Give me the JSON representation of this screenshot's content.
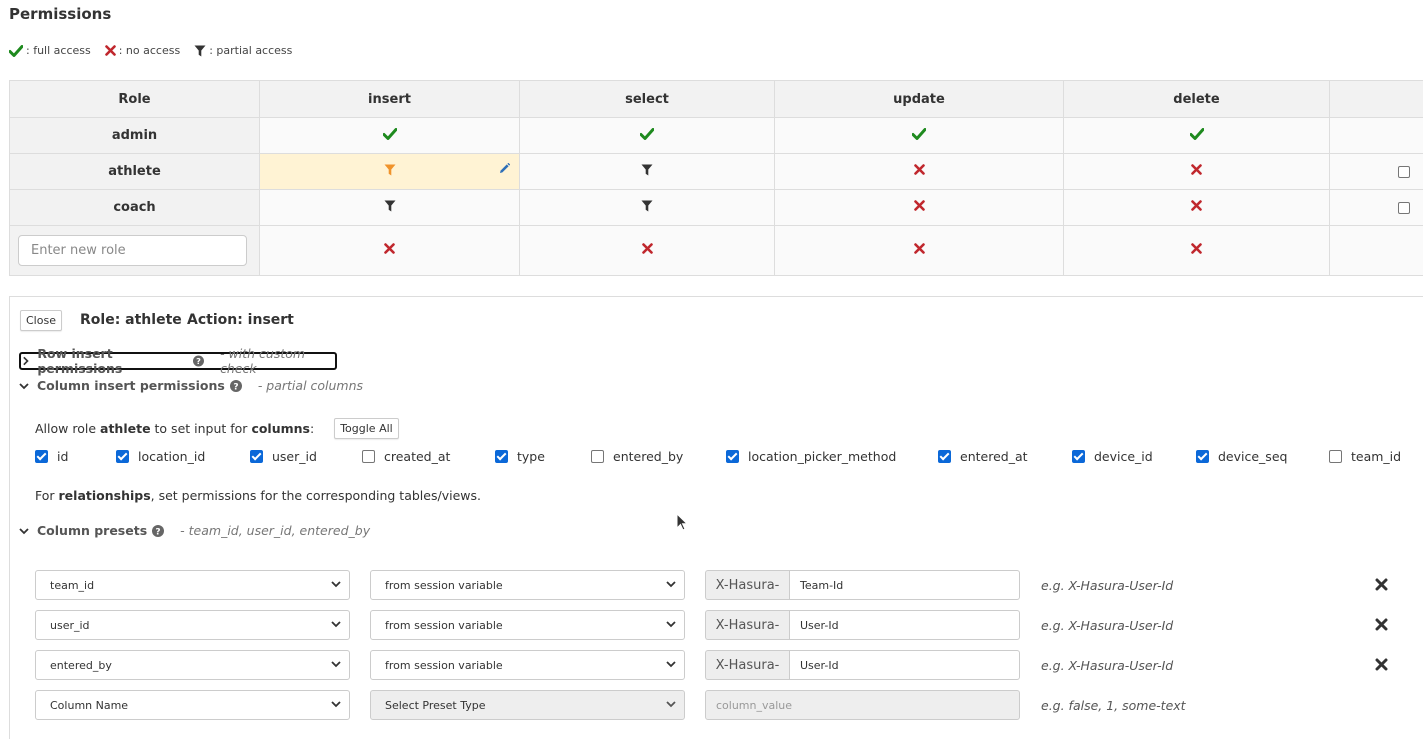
{
  "page": {
    "title": "Permissions"
  },
  "legend": {
    "full": ": full access",
    "none": ": no access",
    "partial": ": partial access"
  },
  "colors": {
    "full": "#1e8a1e",
    "none": "#c0272d",
    "partial": "#333333",
    "partial_selected": "#f0932b",
    "selected_cell": "#fff3d4",
    "pencil": "#2e6fb8"
  },
  "table": {
    "headers": {
      "role": "Role",
      "insert": "insert",
      "select": "select",
      "update": "update",
      "delete": "delete"
    },
    "rows": [
      {
        "role": "admin",
        "insert": "full",
        "select": "full",
        "update": "full",
        "delete": "full",
        "checkbox": false
      },
      {
        "role": "athlete",
        "insert": "partial",
        "select": "partial",
        "update": "none",
        "delete": "none",
        "checkbox": true
      },
      {
        "role": "coach",
        "insert": "partial",
        "select": "partial",
        "update": "none",
        "delete": "none",
        "checkbox": true
      }
    ],
    "new_role": {
      "placeholder": "Enter new role",
      "insert": "none",
      "select": "none",
      "update": "none",
      "delete": "none"
    }
  },
  "panel": {
    "close_label": "Close",
    "role_heading": "Role: athlete",
    "action_heading": "Action: insert",
    "row_section": {
      "title": "Row insert permissions",
      "subtitle": "- with custom check"
    },
    "column_section": {
      "title": "Column insert permissions",
      "subtitle": "- partial columns"
    },
    "allow": {
      "prefix": "Allow role",
      "role": "athlete",
      "middle": "to set input for",
      "columns_word": "columns",
      "suffix": ":",
      "toggle_label": "Toggle All"
    },
    "columns": [
      {
        "name": "id",
        "checked": true
      },
      {
        "name": "location_id",
        "checked": true
      },
      {
        "name": "user_id",
        "checked": true
      },
      {
        "name": "created_at",
        "checked": false
      },
      {
        "name": "type",
        "checked": true
      },
      {
        "name": "entered_by",
        "checked": false
      },
      {
        "name": "location_picker_method",
        "checked": true
      },
      {
        "name": "entered_at",
        "checked": true
      },
      {
        "name": "device_id",
        "checked": true
      },
      {
        "name": "device_seq",
        "checked": true
      },
      {
        "name": "team_id",
        "checked": false
      }
    ],
    "relationships": {
      "prefix": "For",
      "bold": "relationships",
      "suffix": ", set permissions for the corresponding tables/views."
    },
    "preset_section": {
      "title": "Column presets",
      "subtitle": "- team_id, user_id, entered_by"
    },
    "presets": [
      {
        "column": "team_id",
        "type": "from session variable",
        "prefix": "X-Hasura-",
        "value": "Team-Id",
        "example": "e.g. X-Hasura-User-Id"
      },
      {
        "column": "user_id",
        "type": "from session variable",
        "prefix": "X-Hasura-",
        "value": "User-Id",
        "example": "e.g. X-Hasura-User-Id"
      },
      {
        "column": "entered_by",
        "type": "from session variable",
        "prefix": "X-Hasura-",
        "value": "User-Id",
        "example": "e.g. X-Hasura-User-Id"
      }
    ],
    "new_preset": {
      "column": "Column Name",
      "type": "Select Preset Type",
      "value_placeholder": "column_value",
      "example": "e.g. false, 1, some-text"
    }
  }
}
